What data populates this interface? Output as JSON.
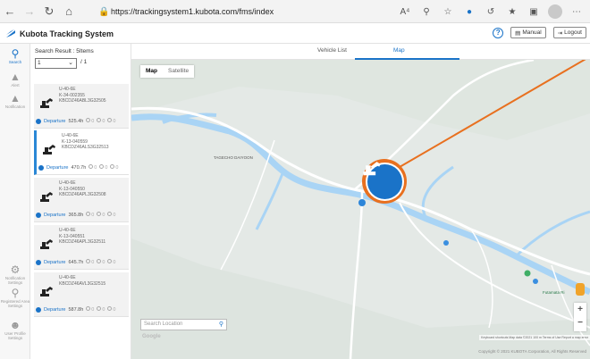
{
  "browser": {
    "url": "https://trackingsystem1.kubota.com/fms/index"
  },
  "header": {
    "brand": "Kubota Tracking System",
    "manual_label": "Manual",
    "logout_label": "Logout"
  },
  "rail": {
    "items": [
      {
        "label": "Search",
        "icon": "search-icon"
      },
      {
        "label": "Alert",
        "icon": "warning-icon"
      },
      {
        "label": "Notification",
        "icon": "bell-icon"
      },
      {
        "label": "Notification Settings",
        "icon": "gear-icon"
      },
      {
        "label": "Registered Area Settings",
        "icon": "area-icon"
      },
      {
        "label": "User Profile Settings",
        "icon": "user-icon"
      }
    ]
  },
  "list": {
    "search_result": "Search Result : 5Items",
    "page_value": "1",
    "page_total": "/ 1",
    "vehicles": [
      {
        "model": "U-40-6E",
        "reg": "K-34-002355",
        "serial": "KBCDZ46ABL3G32505",
        "status": "Departure",
        "hours": "525.4h",
        "counts": [
          "0",
          "0",
          "0"
        ]
      },
      {
        "model": "U-40-6E",
        "reg": "K-13-040559",
        "serial": "KBCDZ46ALS3G32513",
        "status": "Departure",
        "hours": "470.7h",
        "counts": [
          "0",
          "0",
          "0"
        ]
      },
      {
        "model": "U-40-6E",
        "reg": "K-13-040550",
        "serial": "KBCDZ46APL3G32508",
        "status": "Departure",
        "hours": "365.8h",
        "counts": [
          "0",
          "0",
          "0"
        ]
      },
      {
        "model": "U-40-6E",
        "reg": "K-13-040551",
        "serial": "KBCDZ46APL3G32511",
        "status": "Departure",
        "hours": "645.7h",
        "counts": [
          "0",
          "0",
          "0"
        ]
      },
      {
        "model": "U-40-6E",
        "reg": "",
        "serial": "KBCDZ46AVL3G32515",
        "status": "Departure",
        "hours": "587.8h",
        "counts": [
          "0",
          "0",
          "0"
        ]
      }
    ]
  },
  "tabs": {
    "vehicle_list": "Vehicle List",
    "map": "Map"
  },
  "map": {
    "type_map": "Map",
    "type_satellite": "Satellite",
    "search_placeholder": "Search Location",
    "labels": [
      "TAGECHO DAIYOON",
      "Futamata Ri"
    ],
    "footer": "Keyboard shortcuts  Map data ©2021   100 m  Terms of Use  Report a map error",
    "copyright": "Copyright © 2021 KUBOTA Corporation, All Rights Reserved",
    "google": "Google"
  },
  "colors": {
    "accent": "#1a73c8",
    "marker_ring": "#e8701f",
    "callout_line": "#e8701f",
    "river": "#a9d4f5"
  }
}
